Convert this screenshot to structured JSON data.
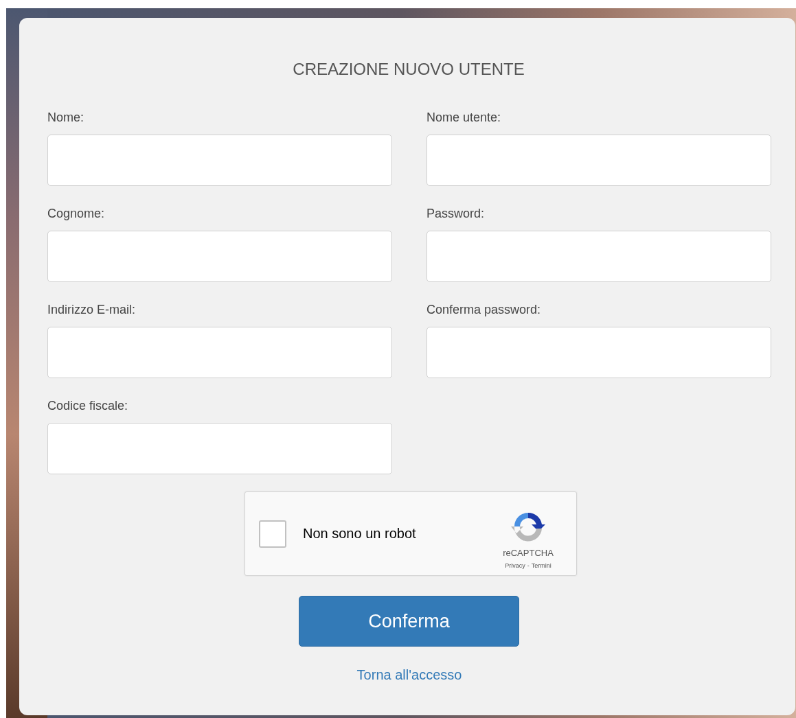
{
  "title": "CREAZIONE NUOVO UTENTE",
  "left_fields": [
    {
      "label": "Nome:"
    },
    {
      "label": "Cognome:"
    },
    {
      "label": "Indirizzo E-mail:"
    },
    {
      "label": "Codice fiscale:"
    }
  ],
  "right_fields": [
    {
      "label": "Nome utente:"
    },
    {
      "label": "Password:"
    },
    {
      "label": "Conferma password:"
    }
  ],
  "captcha": {
    "label": "Non sono un robot",
    "checked": false,
    "brand": "reCAPTCHA",
    "links": [
      "Privacy",
      "Termini"
    ],
    "separator": "-"
  },
  "submit_button": "Conferma",
  "back_link": "Torna all'accesso"
}
